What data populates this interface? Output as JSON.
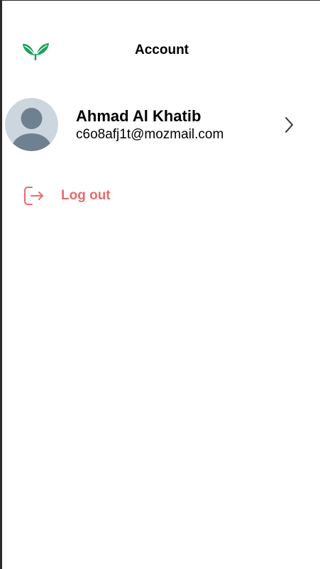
{
  "header": {
    "title": "Account",
    "logo_icon": "leaf-sprout-icon"
  },
  "profile": {
    "name": "Ahmad Al Khatib",
    "email": "c6o8afj1t@mozmail.com",
    "avatar_icon": "default-avatar-icon",
    "chevron_icon": "chevron-right-icon"
  },
  "actions": {
    "logout_label": "Log out",
    "logout_icon": "logout-icon"
  },
  "colors": {
    "brand_green": "#1aa15c",
    "logout_red": "#ea6b6b",
    "avatar_bg": "#ccd6de",
    "avatar_fg": "#6f8191"
  }
}
